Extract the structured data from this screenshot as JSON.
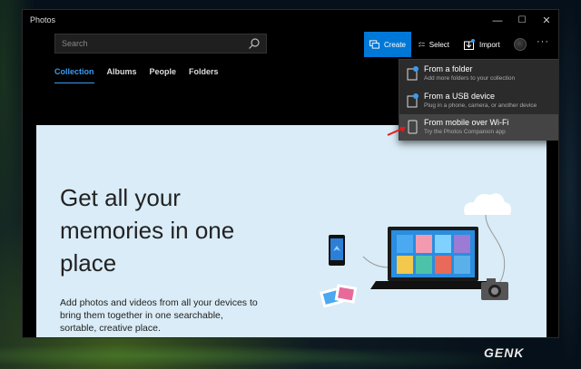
{
  "window": {
    "title": "Photos"
  },
  "controls": {
    "minimize": "—",
    "maximize": "☐",
    "close": "✕"
  },
  "search": {
    "placeholder": "Search"
  },
  "toolbar": {
    "create_label": "Create",
    "select_label": "Select",
    "import_label": "Import",
    "more_label": "···"
  },
  "tabs": [
    {
      "label": "Collection",
      "active": true
    },
    {
      "label": "Albums"
    },
    {
      "label": "People"
    },
    {
      "label": "Folders"
    }
  ],
  "import_menu": {
    "items": [
      {
        "title": "From a folder",
        "subtitle": "Add more folders to your collection"
      },
      {
        "title": "From a USB device",
        "subtitle": "Plug in a phone, camera, or another device"
      },
      {
        "title": "From mobile over Wi-Fi",
        "subtitle": "Try the Photos Companion app",
        "highlighted": true
      }
    ]
  },
  "hero": {
    "headline": "Get all your memories in one place",
    "body": "Add photos and videos from all your devices to bring them together in one searchable, sortable, creative place."
  },
  "watermark": "GENK",
  "colors": {
    "accent": "#0078d7",
    "panel": "#d9ecf7",
    "annotation_arrow": "#e21b1b"
  }
}
